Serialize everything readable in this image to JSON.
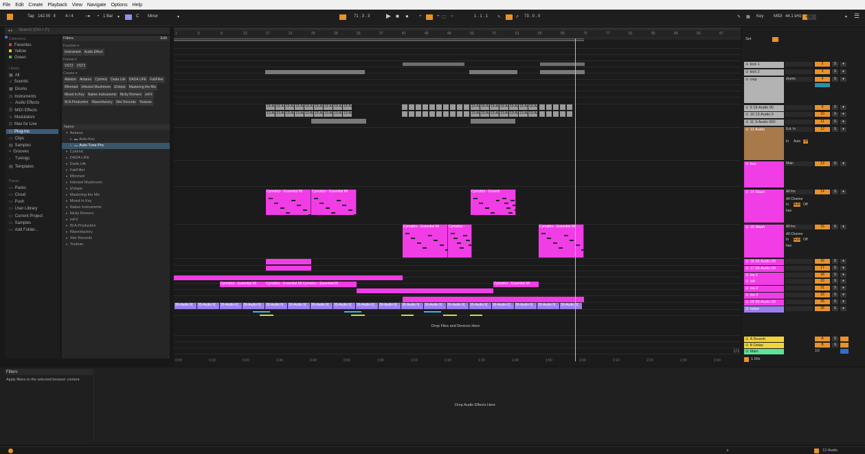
{
  "menu": [
    "File",
    "Edit",
    "Create",
    "Playback",
    "View",
    "Navigate",
    "Options",
    "Help"
  ],
  "transport": {
    "tap": "Tap",
    "tempo": "142.00",
    "signature": "4 / 4",
    "quantize": "1 Bar",
    "key": "C",
    "scale": "Minor",
    "position": "71 .  3 .  3",
    "loop_start": "1 .  1 .  1",
    "loop_len": "73 .  0 .  0",
    "key_label": "Key",
    "midi_label": "MIDI",
    "sample_rate": "44.1 kHz",
    "cpu": "4 %"
  },
  "browser": {
    "search_placeholder": "Search (Ctrl + F)",
    "filters_label": "Filters",
    "edit_label": "Edit",
    "collections_title": "Collections",
    "collections": [
      {
        "label": "Favorites",
        "color": "#e53935"
      },
      {
        "label": "Yellow",
        "color": "#f1c40f"
      },
      {
        "label": "Green",
        "color": "#39c24a"
      }
    ],
    "library_title": "Library",
    "library": [
      "All",
      "Sounds",
      "Drums",
      "Instruments",
      "Audio Effects",
      "MIDI Effects",
      "Modulators",
      "Max for Live",
      "Plug-Ins",
      "Clips",
      "Samples",
      "Grooves",
      "Tunings",
      "Templates"
    ],
    "places_title": "Places",
    "places": [
      "Packs",
      "Cloud",
      "Push",
      "User Library",
      "Current Project",
      "Samples",
      "Add Folder..."
    ],
    "function_label": "Function",
    "function_tags": [
      "Instrument",
      "Audio Effect"
    ],
    "format_label": "Format",
    "format_tags": [
      "VST2",
      "VST3"
    ],
    "creator_label": "Creator",
    "creator_tags": [
      "Ableton",
      "Antares",
      "Cytomic",
      "Dada Life",
      "DADA LIFE",
      "FabFilter",
      "Illformed",
      "Infected Mushroom",
      "iZotope",
      "Mastering the Mix",
      "Mixed In Key",
      "Native Instruments",
      "Nicky Romero",
      "reFX",
      "W.A.Production",
      "Wavesfactory",
      "Xfer Records",
      "Youlean"
    ],
    "name_header": "Name",
    "tree": [
      "Antares",
      "Auto-Key",
      "Auto-Tune Pro",
      "Cytomic",
      "DADA LIFE",
      "Dada Life",
      "FabFilter",
      "Illformed",
      "Infected Mushroom",
      "iZotope",
      "Mastering the Mix",
      "Mixed In Key",
      "Native Instruments",
      "Nicky Romero",
      "reFX",
      "W.A.Production",
      "Wavesfactory",
      "Xfer Records",
      "Youlean"
    ]
  },
  "ruler_bars": [
    "1",
    "5",
    "9",
    "13",
    "17",
    "21",
    "25",
    "29",
    "33",
    "37",
    "41",
    "45",
    "49",
    "53",
    "57",
    "61",
    "65",
    "69",
    "73",
    "77",
    "81",
    "85",
    "89",
    "93",
    "97"
  ],
  "time_labels": [
    "0:00",
    "0:10",
    "0:20",
    "0:30",
    "0:40",
    "0:50",
    "1:00",
    "1:10",
    "1:20",
    "1:30",
    "1:40",
    "1:50",
    "2:00",
    "2:10",
    "2:20",
    "2:30",
    "2:40"
  ],
  "clip_labels": {
    "audio19": "19-Au",
    "audio13": "13-Au",
    "cymatics": "Cymatics - Essential Mi",
    "cymatics2": "Cymatics - Essential Mi",
    "cymatics_short": "Cymatics -",
    "audio30": "30-Audio 0(",
    "drop_files": "Drop Files and Devices Here"
  },
  "mixer": {
    "set_label": "Set",
    "tracks": [
      {
        "name": "kick 1",
        "num": "2",
        "color": "#b3b3b3"
      },
      {
        "name": "kick 2",
        "num": "3",
        "color": "#b3b3b3"
      },
      {
        "name": "clap",
        "num": "4",
        "color": "#b3b3b3",
        "routing": "drums"
      },
      {
        "name": "9 19-Audio 00",
        "num": "9",
        "color": "#b3b3b3"
      },
      {
        "name": "10 13-Audio 0",
        "num": "10",
        "color": "#b3b3b3"
      },
      {
        "name": "11 3-Audio 000",
        "num": "11",
        "color": "#b3b3b3"
      },
      {
        "name": "12 Audio",
        "num": "12",
        "color": "#a87a4a",
        "routing": "Ext. In"
      },
      {
        "name": "bas",
        "num": "13",
        "color": "#f13de6",
        "routing": "Main"
      },
      {
        "name": "14 Wash",
        "num": "14",
        "color": "#f13de6",
        "routing": "All Ins"
      },
      {
        "name": "15 Wash",
        "num": "15",
        "color": "#f13de6",
        "routing": "All Ins"
      },
      {
        "name": "16 26-Audio 00",
        "num": "16",
        "color": "#f13de6"
      },
      {
        "name": "17 26-Audio 00",
        "num": "17",
        "color": "#f13de6"
      },
      {
        "name": "ins 1",
        "num": "18",
        "color": "#f13de6"
      },
      {
        "name": "left",
        "num": "20",
        "color": "#f13de6"
      },
      {
        "name": "ins 2",
        "num": "21",
        "color": "#f13de6"
      },
      {
        "name": "ins 3",
        "num": "23",
        "color": "#f13de6"
      },
      {
        "name": "29 30-Audio 00",
        "num": "25",
        "color": "#f13de6"
      },
      {
        "name": "noise",
        "num": "26",
        "color": "#9b7ff0"
      }
    ],
    "returns": [
      {
        "name": "A Reverb",
        "num": "A",
        "color": "#f0d43a"
      },
      {
        "name": "B Delay",
        "num": "B",
        "color": "#f0d43a"
      }
    ],
    "main": {
      "name": "Main",
      "color": "#5ee39a",
      "routing": "1/2"
    },
    "all_channels": "All Channe",
    "in_label": "In",
    "auto_label": "Auto",
    "off_label": "Off",
    "bas_label": "bas",
    "zoom": "1.00x",
    "page": "1/1"
  },
  "bottom": {
    "filters_title": "Filters",
    "filters_desc": "Apply filters to the selected browser content.",
    "drop_effects": "Drop Audio Effects Here"
  },
  "status": {
    "track": "12-Audio"
  }
}
